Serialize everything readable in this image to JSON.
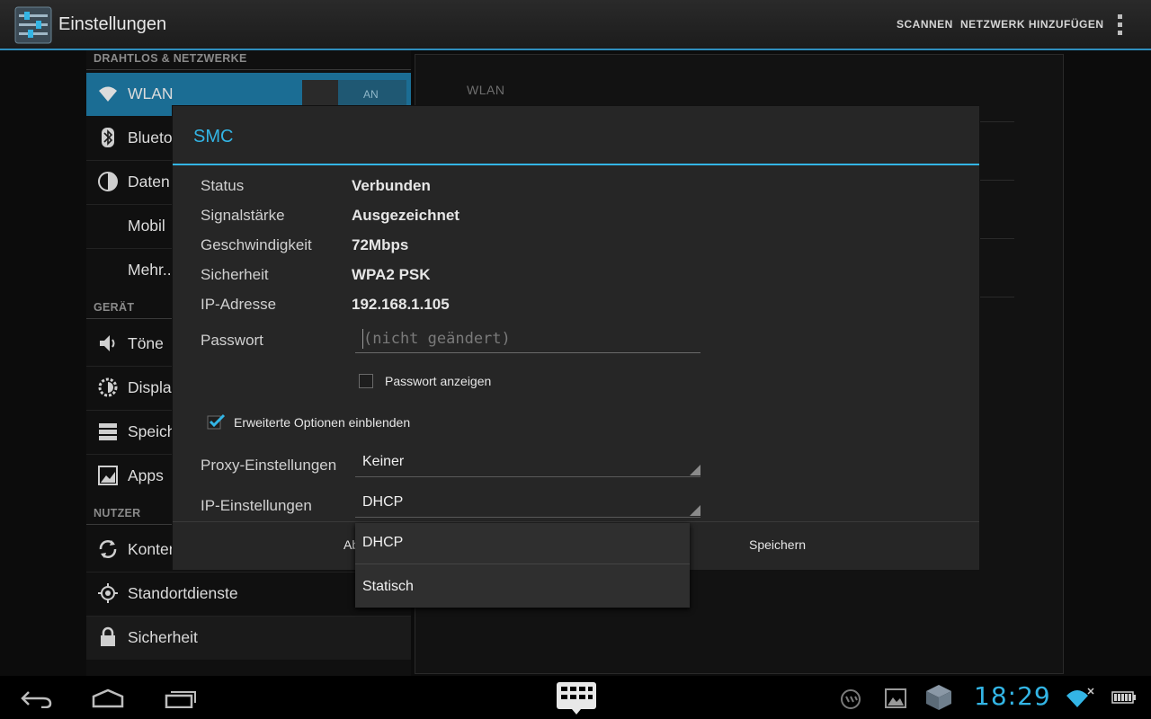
{
  "actionbar": {
    "title": "Einstellungen",
    "actions": {
      "scan": "SCANNEN",
      "add_network": "NETZWERK HINZUFÜGEN"
    }
  },
  "sidebar": {
    "sections": {
      "wireless": "DRAHTLOS & NETZWERKE",
      "device": "GERÄT",
      "user": "NUTZER"
    },
    "items": [
      {
        "label": "WLAN",
        "icon": "wifi-icon"
      },
      {
        "label": "Blueto",
        "icon": "bluetooth-icon"
      },
      {
        "label": "Daten",
        "icon": "data-usage-icon"
      },
      {
        "label": "Mobil"
      },
      {
        "label": "Mehr.."
      },
      {
        "label": "Töne",
        "icon": "volume-icon"
      },
      {
        "label": "Displa",
        "icon": "brightness-icon"
      },
      {
        "label": "Speich",
        "icon": "storage-icon"
      },
      {
        "label": "Apps",
        "icon": "apps-icon"
      },
      {
        "label": "Konten",
        "icon": "sync-icon"
      },
      {
        "label": "Standortdienste",
        "icon": "location-icon"
      },
      {
        "label": "Sicherheit",
        "icon": "lock-icon"
      }
    ],
    "wlan_toggle": "AN"
  },
  "rightpane": {
    "header": "WLAN"
  },
  "dialog": {
    "title": "SMC",
    "info": [
      {
        "label": "Status",
        "value": "Verbunden"
      },
      {
        "label": "Signalstärke",
        "value": "Ausgezeichnet"
      },
      {
        "label": "Geschwindigkeit",
        "value": "72Mbps"
      },
      {
        "label": "Sicherheit",
        "value": "WPA2 PSK"
      },
      {
        "label": "IP-Adresse",
        "value": "192.168.1.105"
      }
    ],
    "password_label": "Passwort",
    "password_placeholder": "(nicht geändert)",
    "show_password": "Passwort anzeigen",
    "show_advanced": "Erweiterte Optionen einblenden",
    "proxy_label": "Proxy-Einstellungen",
    "proxy_value": "Keiner",
    "ip_label": "IP-Einstellungen",
    "ip_value": "DHCP",
    "buttons": {
      "cancel": "Ab",
      "save": "Speichern"
    }
  },
  "dropdown": {
    "options": [
      "DHCP",
      "Statisch"
    ]
  },
  "statusbar": {
    "time": "18:29"
  },
  "colors": {
    "accent": "#33b5e5",
    "selected": "#1b6d94"
  }
}
